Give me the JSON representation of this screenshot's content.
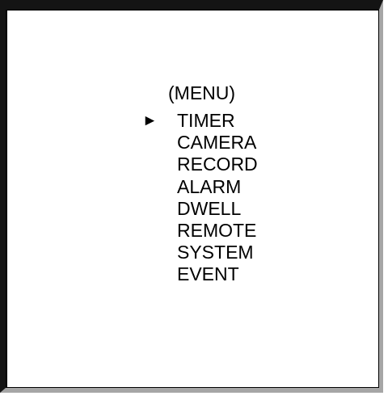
{
  "menu": {
    "title": "(MENU)",
    "selector_glyph": "►",
    "items": [
      {
        "label": "TIMER",
        "selected": true
      },
      {
        "label": "CAMERA",
        "selected": false
      },
      {
        "label": "RECORD",
        "selected": false
      },
      {
        "label": "ALARM",
        "selected": false
      },
      {
        "label": "DWELL",
        "selected": false
      },
      {
        "label": "REMOTE",
        "selected": false
      },
      {
        "label": "SYSTEM",
        "selected": false
      },
      {
        "label": "EVENT",
        "selected": false
      }
    ]
  }
}
